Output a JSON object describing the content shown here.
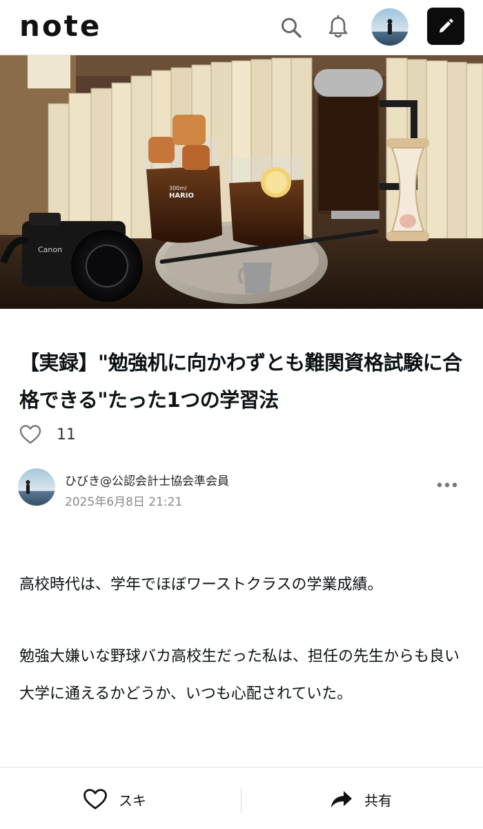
{
  "header": {
    "logo": "note",
    "icons": [
      "search-icon",
      "bell-icon",
      "user-avatar",
      "pencil-icon"
    ]
  },
  "hero": {
    "alt": "Iced coffee in beakers, French press, hourglass and camera in front of a bookshelf",
    "camera_brand": "Canon",
    "beaker_brand": "HARIO",
    "beaker_capacity": "300ml"
  },
  "article": {
    "title": "【実録】\"勉強机に向かわずとも難関資格試験に合格できる\"たった1つの学習法",
    "like_count": "11",
    "author": {
      "name": "ひびき@公認会計士協会準会員",
      "date": "2025年6月8日 21:21"
    },
    "paragraphs": [
      "高校時代は、学年でほぼワーストクラスの学業成績。",
      "勉強大嫌いな野球バカ高校生だった私は、担任の先生からも良い大学に通えるかどうか、いつも心配されていた。"
    ]
  },
  "bottom_bar": {
    "like_label": "スキ",
    "share_label": "共有"
  },
  "colors": {
    "text": "#0c1216",
    "muted": "#888888",
    "post_button": "#0c0c0c"
  }
}
